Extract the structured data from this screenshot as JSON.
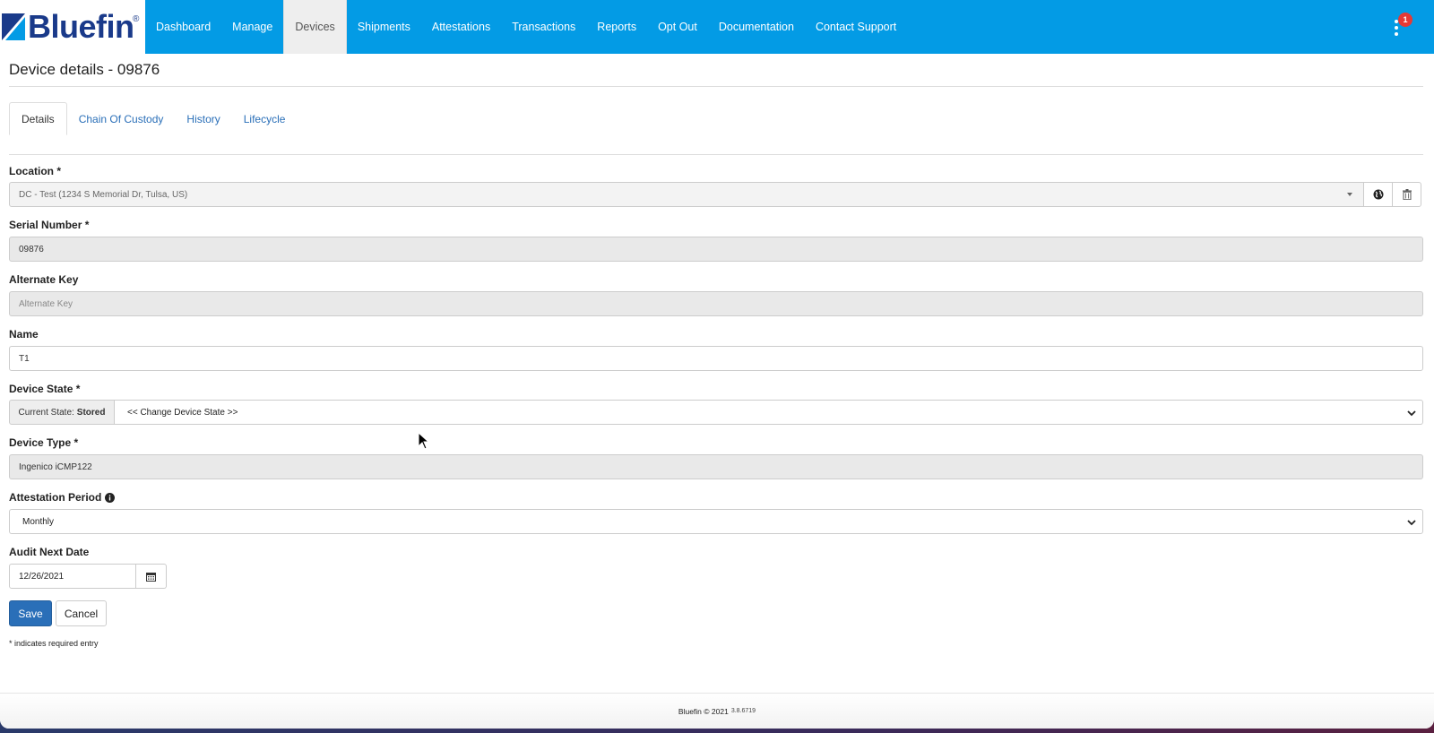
{
  "brand": {
    "name": "Bluefin",
    "reg": "®"
  },
  "nav": {
    "items": [
      {
        "label": "Dashboard"
      },
      {
        "label": "Manage"
      },
      {
        "label": "Devices"
      },
      {
        "label": "Shipments"
      },
      {
        "label": "Attestations"
      },
      {
        "label": "Transactions"
      },
      {
        "label": "Reports"
      },
      {
        "label": "Opt Out"
      },
      {
        "label": "Documentation"
      },
      {
        "label": "Contact Support"
      }
    ],
    "active_index": 2,
    "notification_count": "1"
  },
  "page": {
    "title": "Device details - 09876"
  },
  "tabs": [
    {
      "label": "Details"
    },
    {
      "label": "Chain Of Custody"
    },
    {
      "label": "History"
    },
    {
      "label": "Lifecycle"
    }
  ],
  "form": {
    "location": {
      "label": "Location *",
      "value": "DC - Test (1234 S Memorial Dr, Tulsa, US)"
    },
    "serial": {
      "label": "Serial Number *",
      "value": "09876"
    },
    "alternate": {
      "label": "Alternate Key",
      "placeholder": "Alternate Key"
    },
    "name": {
      "label": "Name",
      "value": "T1"
    },
    "state": {
      "label": "Device State *",
      "current_prefix": "Current State:",
      "current_value": "Stored",
      "select_value": "<< Change Device State >>"
    },
    "type": {
      "label": "Device Type *",
      "value": "Ingenico iCMP122"
    },
    "attestation": {
      "label": "Attestation Period",
      "value": "Monthly"
    },
    "audit": {
      "label": "Audit Next Date",
      "value": "12/26/2021"
    },
    "save_label": "Save",
    "cancel_label": "Cancel",
    "required_note": "* indicates required entry"
  },
  "footer": {
    "copyright": "Bluefin © 2021",
    "version": "3.8.6719"
  },
  "colors": {
    "navbar": "#039be5",
    "brand": "#1a3a8a",
    "primary": "#2a6fb8",
    "badge": "#e53935"
  }
}
